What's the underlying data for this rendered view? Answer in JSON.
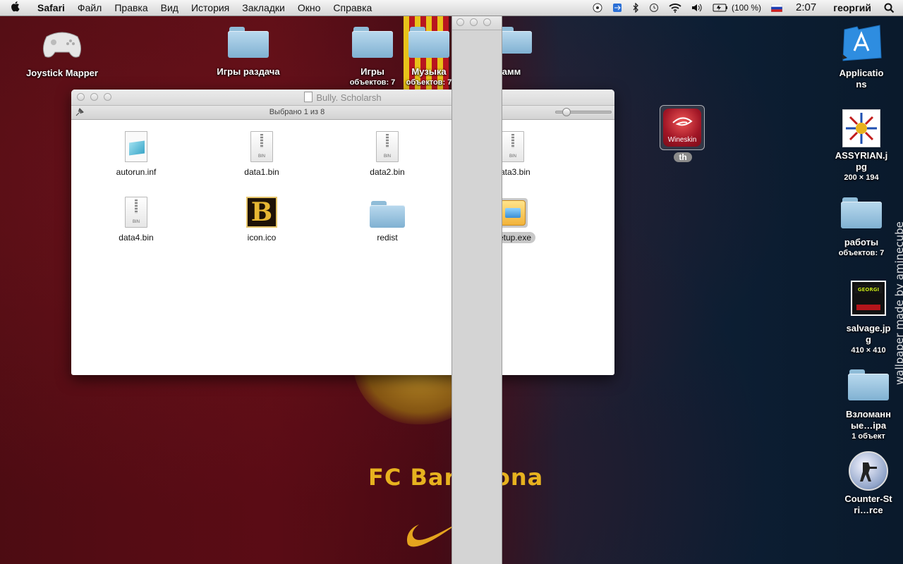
{
  "menubar": {
    "app": "Safari",
    "items": [
      "Файл",
      "Правка",
      "Вид",
      "История",
      "Закладки",
      "Окно",
      "Справка"
    ],
    "battery": "(100 %)",
    "time": "2:07",
    "user": "георгий"
  },
  "desktop_left": [
    {
      "name": "Joystick Mapper",
      "sub": ""
    },
    {
      "name": "Игры раздача",
      "sub": ""
    },
    {
      "name": "Игры",
      "sub": "объектов: 7"
    },
    {
      "name": "Музыка",
      "sub": "объектов: 7"
    },
    {
      "name": "амм",
      "sub": ""
    }
  ],
  "desktop_right": [
    {
      "name": "Applications",
      "sub": ""
    },
    {
      "name": "ASSYRIAN.jpg",
      "sub": "200 × 194"
    },
    {
      "name": "работы",
      "sub": "объектов: 7"
    },
    {
      "name": "salvage.jpg",
      "sub": "410 × 410"
    },
    {
      "name": "Взломанные…ipa",
      "sub": "1 объект"
    },
    {
      "name": "Counter-Stri…rce",
      "sub": ""
    }
  ],
  "wineskin": {
    "badge": "Wineskin",
    "label": "th"
  },
  "wallpaper": {
    "club_text": "FC Barcelona",
    "credit": "wallpaper made by aminecube"
  },
  "finder": {
    "title": "Bully. Scholarsh",
    "status": "Выбрано 1 из 8",
    "icon_size_fraction": 0.15,
    "files": [
      {
        "name": "autorun.inf",
        "kind": "inf",
        "selected": false
      },
      {
        "name": "data1.bin",
        "kind": "bin",
        "selected": false
      },
      {
        "name": "data2.bin",
        "kind": "bin",
        "selected": false
      },
      {
        "name": "data3.bin",
        "kind": "bin",
        "selected": false
      },
      {
        "name": "data4.bin",
        "kind": "bin",
        "selected": false
      },
      {
        "name": "icon.ico",
        "kind": "ico",
        "selected": false
      },
      {
        "name": "redist",
        "kind": "folder",
        "selected": false
      },
      {
        "name": "setup.exe",
        "kind": "exe",
        "selected": true
      }
    ]
  },
  "icons": {
    "apple": "apple-icon",
    "spotlight": "spotlight-icon",
    "wifi": "wifi-icon",
    "bluetooth": "bluetooth-icon",
    "volume": "volume-icon",
    "battery": "battery-icon",
    "flag": "russian-flag-icon"
  }
}
